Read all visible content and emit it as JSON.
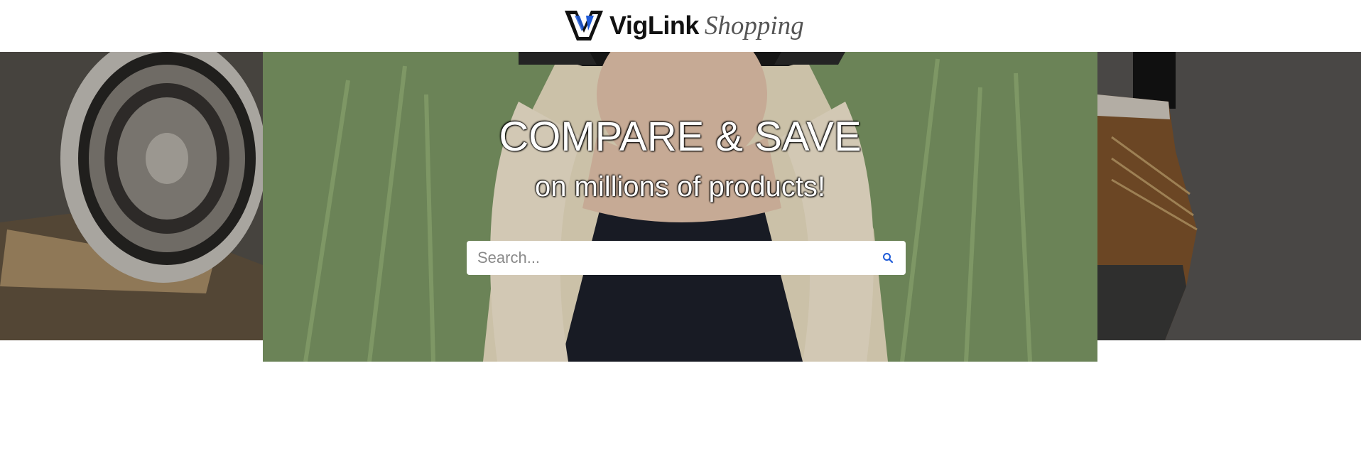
{
  "header": {
    "logo_brand": "VigLink",
    "logo_sub": "Shopping"
  },
  "hero": {
    "headline": "COMPARE & SAVE",
    "subline": "on millions of products!"
  },
  "search": {
    "placeholder": "Search..."
  },
  "colors": {
    "accent": "#1f5bd8",
    "logo_dark": "#111111",
    "logo_sub": "#555555"
  }
}
